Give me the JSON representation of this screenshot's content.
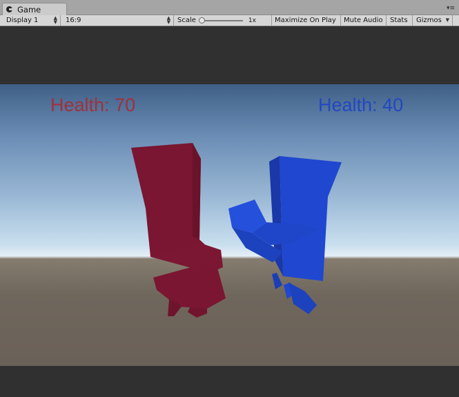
{
  "window": {
    "tab_title": "Game",
    "tab_icon": "game-controller-icon",
    "tab_menu_icon": "tab-menu-icon"
  },
  "toolbar": {
    "display": "Display 1",
    "aspect": "16:9",
    "scale_label": "Scale",
    "scale_value": "1x",
    "scale_fraction": 0.0,
    "maximize": "Maximize On Play",
    "mute": "Mute Audio",
    "stats": "Stats",
    "gizmos": "Gizmos"
  },
  "game": {
    "red_health": "Health: 70",
    "blue_health": "Health: 40",
    "colors": {
      "red_player": "#7a1631",
      "blue_player": "#1f47cf",
      "red_text": "#a2303a",
      "blue_text": "#2247c2"
    }
  }
}
